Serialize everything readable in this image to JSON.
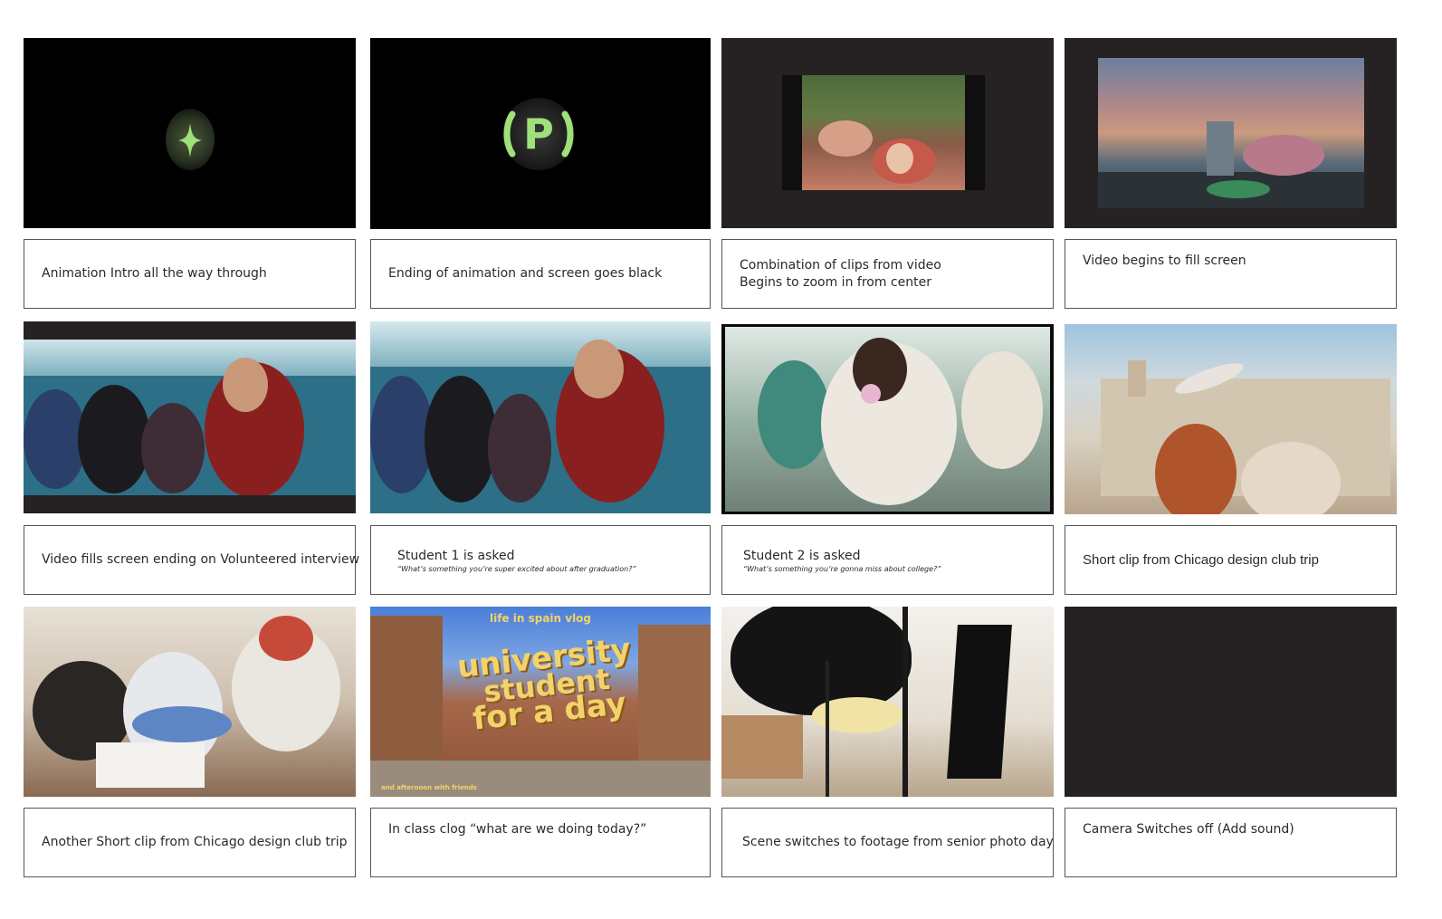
{
  "panels": [
    {
      "id": "p1",
      "caption": [
        "Animation Intro all the way through"
      ]
    },
    {
      "id": "p2",
      "caption": [
        "Ending of animation and screen goes black"
      ]
    },
    {
      "id": "p3",
      "caption": [
        "Combination of clips from video",
        "Begins to zoom in from center"
      ]
    },
    {
      "id": "p4",
      "caption": [
        "Video begins to fill screen"
      ]
    },
    {
      "id": "p5",
      "caption": [
        "Video fills screen ending on Volunteered interview"
      ]
    },
    {
      "id": "p6",
      "caption": [
        "Student 1 is asked"
      ],
      "quote": "“What’s something you’re super excited about after graduation?”"
    },
    {
      "id": "p7",
      "caption": [
        "Student 2 is asked"
      ],
      "quote": "“What’s something you’re gonna miss about college?”"
    },
    {
      "id": "p8",
      "caption": [
        "Short clip from Chicago design club trip"
      ]
    },
    {
      "id": "p9",
      "caption": [
        "Another Short clip from Chicago design club trip"
      ]
    },
    {
      "id": "p10",
      "caption": [
        "In class clog “what are we doing today?”"
      ]
    },
    {
      "id": "p11",
      "caption": [
        "Scene switches to footage from senior photo day"
      ]
    },
    {
      "id": "p12",
      "caption": [
        "Camera Switches off (Add sound)"
      ]
    }
  ],
  "artwork": {
    "logo_letter": "P",
    "vlog_header": "life in spain vlog",
    "vlog_title": [
      "university",
      "student",
      "for a day"
    ],
    "vlog_footer": "and afternoon with friends"
  },
  "colors": {
    "glow": "#9fe07a",
    "dark_frame": "#262122",
    "border": "#555555"
  }
}
